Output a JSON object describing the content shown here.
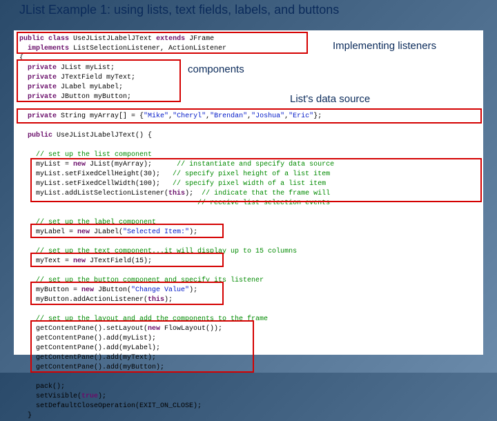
{
  "title": "JList Example 1:  using lists, text fields, labels, and buttons",
  "annotations": {
    "listeners": "Implementing listeners",
    "components": "components",
    "datasource": "List's data source"
  },
  "code": {
    "l01a": "public",
    "l01b": " class",
    "l01c": " UseJListJLabelJText ",
    "l01d": "extends",
    "l01e": " JFrame",
    "l02a": "  implements",
    "l02b": " ListSelectionListener, ActionListener",
    "l03": "{",
    "l04a": "  private",
    "l04b": " JList myList;",
    "l05a": "  private",
    "l05b": " JTextField myText;",
    "l06a": "  private",
    "l06b": " JLabel myLabel;",
    "l07a": "  private",
    "l07b": " JButton myButton;",
    "l08": " ",
    "l09a": "  private",
    "l09b": " String myArray[] = {",
    "l09c": "\"Mike\"",
    "l09d": ",",
    "l09e": "\"Cheryl\"",
    "l09f": ",",
    "l09g": "\"Brendan\"",
    "l09h": ",",
    "l09i": "\"Joshua\"",
    "l09j": ",",
    "l09k": "\"Eric\"",
    "l09l": "};",
    "l10": " ",
    "l11a": "  public",
    "l11b": " UseJListJLabelJText() {",
    "l12": " ",
    "l13": "    // set up the list component",
    "l14a": "    myList = ",
    "l14b": "new",
    "l14c": " JList(myArray);      ",
    "l14d": "// instantiate and specify data source",
    "l15a": "    myList.setFixedCellHeight(30);   ",
    "l15b": "// specify pixel height of a list item",
    "l16a": "    myList.setFixedCellWidth(100);   ",
    "l16b": "// specify pixel width of a list item",
    "l17a": "    myList.addListSelectionListener(",
    "l17b": "this",
    "l17c": ");  ",
    "l17d": "// indicate that the frame will",
    "l18": "                                           // receive list selection events",
    "l19": " ",
    "l20": "    // set up the label component",
    "l21a": "    myLabel = ",
    "l21b": "new",
    "l21c": " JLabel(",
    "l21d": "\"Selected Item:\"",
    "l21e": ");",
    "l22": " ",
    "l23": "    // set up the text component...it will display up to 15 columns",
    "l24a": "    myText = ",
    "l24b": "new",
    "l24c": " JTextField(15);",
    "l25": " ",
    "l26": "    // set up the button component and specify its listener",
    "l27a": "    myButton = ",
    "l27b": "new",
    "l27c": " JButton(",
    "l27d": "\"Change Value\"",
    "l27e": ");",
    "l28a": "    myButton.addActionListener(",
    "l28b": "this",
    "l28c": ");",
    "l29": " ",
    "l30": "    // set up the layout and add the components to the frame",
    "l31a": "    getContentPane().setLayout(",
    "l31b": "new",
    "l31c": " FlowLayout());",
    "l32": "    getContentPane().add(myList);",
    "l33": "    getContentPane().add(myLabel);",
    "l34": "    getContentPane().add(myText);",
    "l35": "    getContentPane().add(myButton);",
    "l36": " ",
    "l37": "    pack();",
    "l38a": "    setVisible(",
    "l38b": "true",
    "l38c": ");",
    "l39": "    setDefaultCloseOperation(EXIT_ON_CLOSE);",
    "l40": "  }"
  }
}
